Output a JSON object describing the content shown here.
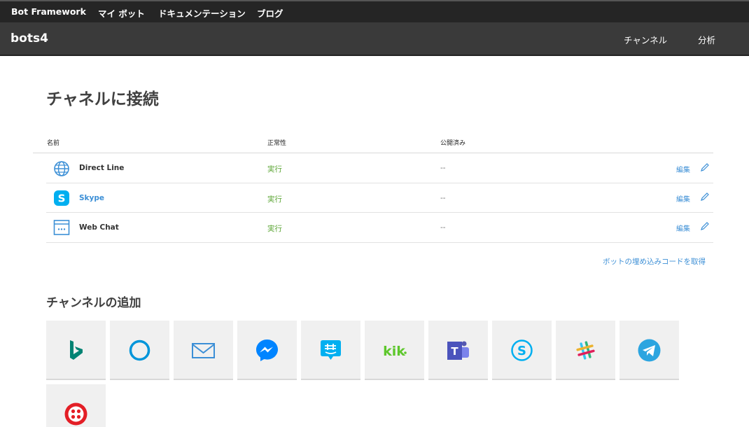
{
  "topbar": {
    "brand": "Bot Framework",
    "nav": [
      "マイ ボット",
      "ドキュメンテーション",
      "ブログ"
    ]
  },
  "subbar": {
    "bot_name": "bots4",
    "links": [
      "チャンネル",
      "分析"
    ]
  },
  "page_title": "チャネルに接続",
  "table": {
    "headers": [
      "名前",
      "正常性",
      "公開済み"
    ],
    "rows": [
      {
        "name": "Direct Line",
        "status": "実行",
        "published": "--",
        "edit": "編集",
        "icon": "globe-icon"
      },
      {
        "name": "Skype",
        "status": "実行",
        "published": "--",
        "edit": "編集",
        "icon": "skype-icon"
      },
      {
        "name": "Web Chat",
        "status": "実行",
        "published": "--",
        "edit": "編集",
        "icon": "web-chat-icon"
      }
    ]
  },
  "embed_link": "ボットの埋め込みコードを取得",
  "add_title": "チャンネルの追加",
  "channels": [
    "bing-icon",
    "cortana-icon",
    "email-icon",
    "messenger-icon",
    "groupme-icon",
    "kik-icon",
    "teams-icon",
    "skype-icon",
    "slack-icon",
    "telegram-icon",
    "twilio-icon"
  ],
  "colors": {
    "topbar": "#252525",
    "subbar": "#3a3a3a",
    "link": "#3c8fd6",
    "status_ok": "#5ba534"
  }
}
